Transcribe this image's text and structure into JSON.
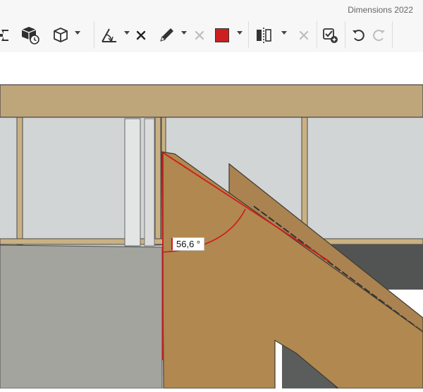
{
  "app": {
    "title": "Dimensions 2022"
  },
  "toolbar": {
    "items": [
      {
        "name": "expand-arrows-icon",
        "interactable": true
      },
      {
        "name": "cube-clock-icon",
        "interactable": true
      },
      {
        "name": "cube-view-icon",
        "interactable": true
      },
      {
        "name": "angle-measure-icon",
        "interactable": true
      },
      {
        "name": "delete-angle-icon",
        "interactable": true
      },
      {
        "name": "pencil-icon",
        "interactable": true
      },
      {
        "name": "delete-pencil-icon",
        "interactable": false
      },
      {
        "name": "color-swatch-icon",
        "interactable": true
      },
      {
        "name": "mirror-icon",
        "interactable": true
      },
      {
        "name": "delete-mirror-icon",
        "interactable": false
      },
      {
        "name": "check-add-icon",
        "interactable": true
      },
      {
        "name": "undo-icon",
        "interactable": true
      },
      {
        "name": "redo-icon",
        "interactable": false
      }
    ],
    "color_swatch": "#cc1f1f"
  },
  "viewport": {
    "angle_label": "56,6 °"
  },
  "colors": {
    "wood": "#b08850",
    "beam": "#bfa57a",
    "window_glass": "#cfd2d4",
    "floor": "#a3a49d",
    "measure_line": "#d11a1a"
  }
}
